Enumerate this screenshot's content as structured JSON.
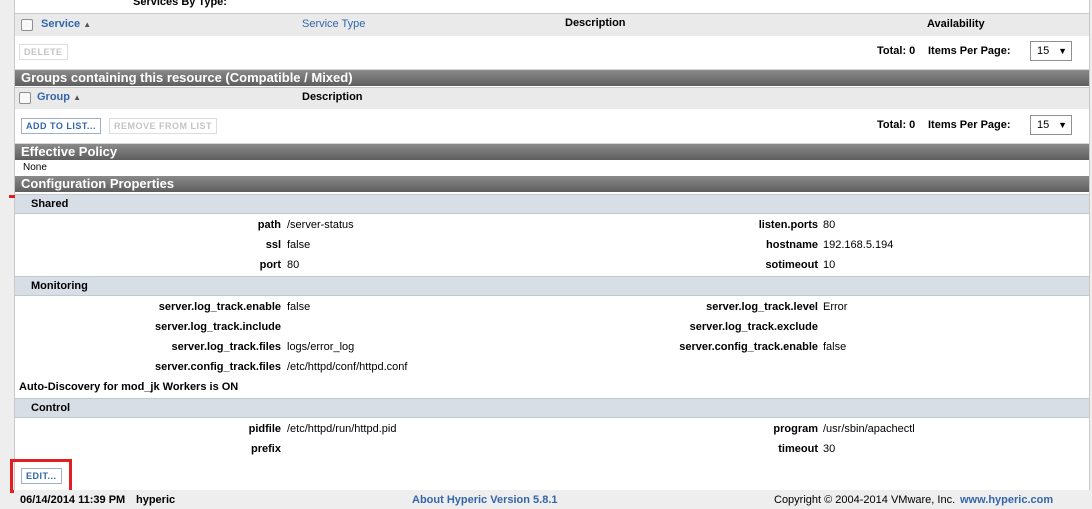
{
  "top_label": "Services By Type:",
  "services_table": {
    "columns": [
      "Service",
      "Service Type",
      "Description",
      "Availability"
    ],
    "sort_indicator": "▲",
    "delete_label": "DELETE",
    "total_label": "Total: 0",
    "items_per_page_label": "Items Per Page:",
    "items_per_page_value": "15"
  },
  "groups": {
    "title": "Groups containing this resource (Compatible / Mixed)",
    "columns": [
      "Group",
      "Description"
    ],
    "add_label": "ADD TO LIST...",
    "remove_label": "REMOVE FROM LIST",
    "total_label": "Total: 0",
    "items_per_page_label": "Items Per Page:",
    "items_per_page_value": "15"
  },
  "effective_policy": {
    "title": "Effective Policy",
    "value": "None"
  },
  "config": {
    "title": "Configuration Properties",
    "shared": {
      "title": "Shared",
      "left": [
        {
          "key": "path",
          "value": "/server-status"
        },
        {
          "key": "ssl",
          "value": "false"
        },
        {
          "key": "port",
          "value": "80"
        }
      ],
      "right": [
        {
          "key": "listen.ports",
          "value": "80"
        },
        {
          "key": "hostname",
          "value": "192.168.5.194"
        },
        {
          "key": "sotimeout",
          "value": "10"
        }
      ]
    },
    "monitoring": {
      "title": "Monitoring",
      "left": [
        {
          "key": "server.log_track.enable",
          "value": "false"
        },
        {
          "key": "server.log_track.include",
          "value": ""
        },
        {
          "key": "server.log_track.files",
          "value": "logs/error_log"
        },
        {
          "key": "server.config_track.files",
          "value": "/etc/httpd/conf/httpd.conf"
        }
      ],
      "right": [
        {
          "key": "server.log_track.level",
          "value": "Error"
        },
        {
          "key": "server.log_track.exclude",
          "value": ""
        },
        {
          "key": "server.config_track.enable",
          "value": "false"
        }
      ],
      "auto_discovery": "Auto-Discovery for mod_jk Workers is ON"
    },
    "control": {
      "title": "Control",
      "left": [
        {
          "key": "pidfile",
          "value": "/etc/httpd/run/httpd.pid"
        },
        {
          "key": "prefix",
          "value": ""
        }
      ],
      "right": [
        {
          "key": "program",
          "value": "/usr/sbin/apachectl"
        },
        {
          "key": "timeout",
          "value": "30"
        }
      ]
    },
    "edit_label": "EDIT..."
  },
  "footer": {
    "datetime": "06/14/2014 11:39 PM",
    "user": "hyperic",
    "about": "About Hyperic Version 5.8.1",
    "copyright": "Copyright © 2004-2014 VMware, Inc.",
    "site": "www.hyperic.com"
  },
  "colors": {
    "link": "#3366aa",
    "section_header": "#6e6e6e",
    "subsection": "#d8dee6",
    "annotation": "#e02020"
  }
}
